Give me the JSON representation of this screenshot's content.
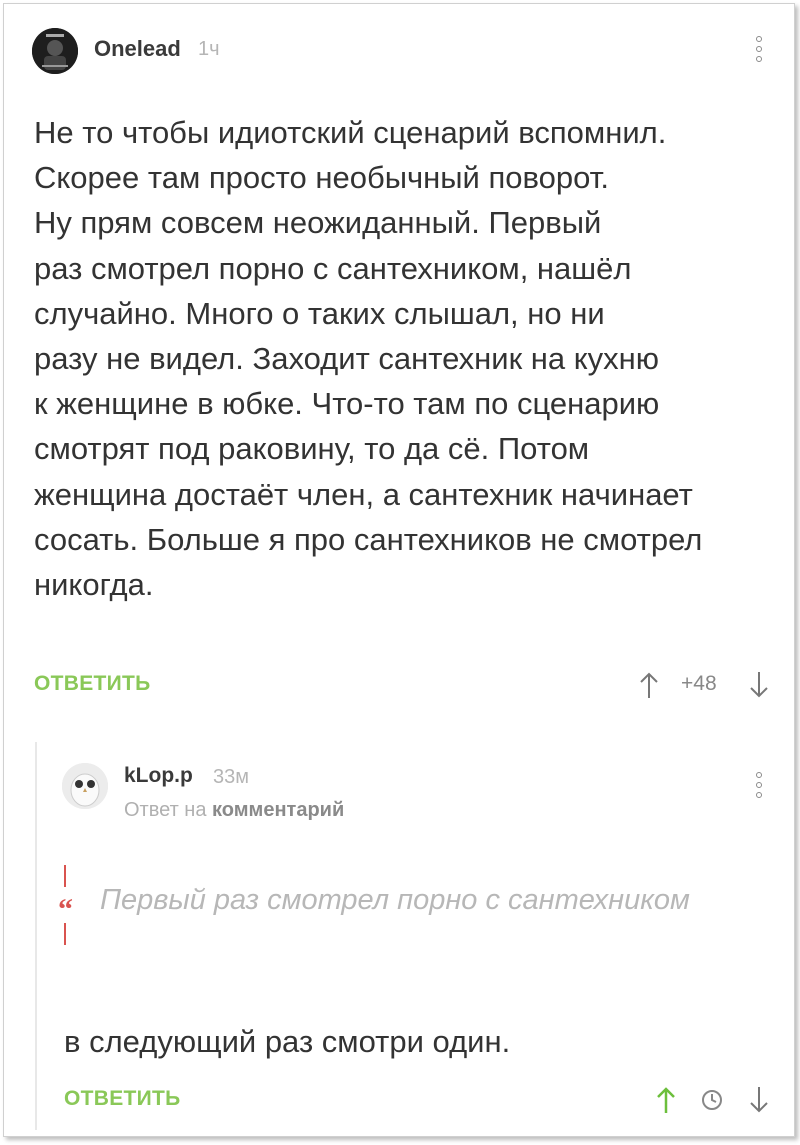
{
  "comment": {
    "author": "Onelead",
    "time": "1ч",
    "lines": [
      "Не то чтобы идиотский сценарий вспомнил.",
      "Скорее там просто необычный поворот.",
      "Ну прям совсем неожиданный. Первый",
      "раз смотрел порно с сантехником, нашёл",
      "случайно. Много о таких слышал, но ни",
      "разу не видел. Заходит сантехник на кухню",
      "к женщине в юбке. Что-то там по сценарию",
      "смотрят под раковину, то да сё. Потом",
      "женщина достаёт член, а сантехник начинает",
      "сосать. Больше я про сантехников не смотрел",
      "никогда."
    ],
    "reply_label": "ОТВЕТИТЬ",
    "rating": "+48",
    "avatar_icon": "user-avatar-dark",
    "menu_icon": "more-vertical-icon"
  },
  "reply": {
    "author": "kLop.p",
    "time": "33м",
    "reply_to_prefix": "Ответ на",
    "reply_to_target": "комментарий",
    "quote": "Первый раз смотрел порно с сантехником",
    "text": "в следующий раз смотри один.",
    "reply_label": "ОТВЕТИТЬ",
    "avatar_icon": "owl-avatar",
    "menu_icon": "more-vertical-icon"
  },
  "colors": {
    "accent_green": "#8ac858",
    "quote_red": "#d9534f",
    "muted_gray": "#b5b5b5"
  }
}
